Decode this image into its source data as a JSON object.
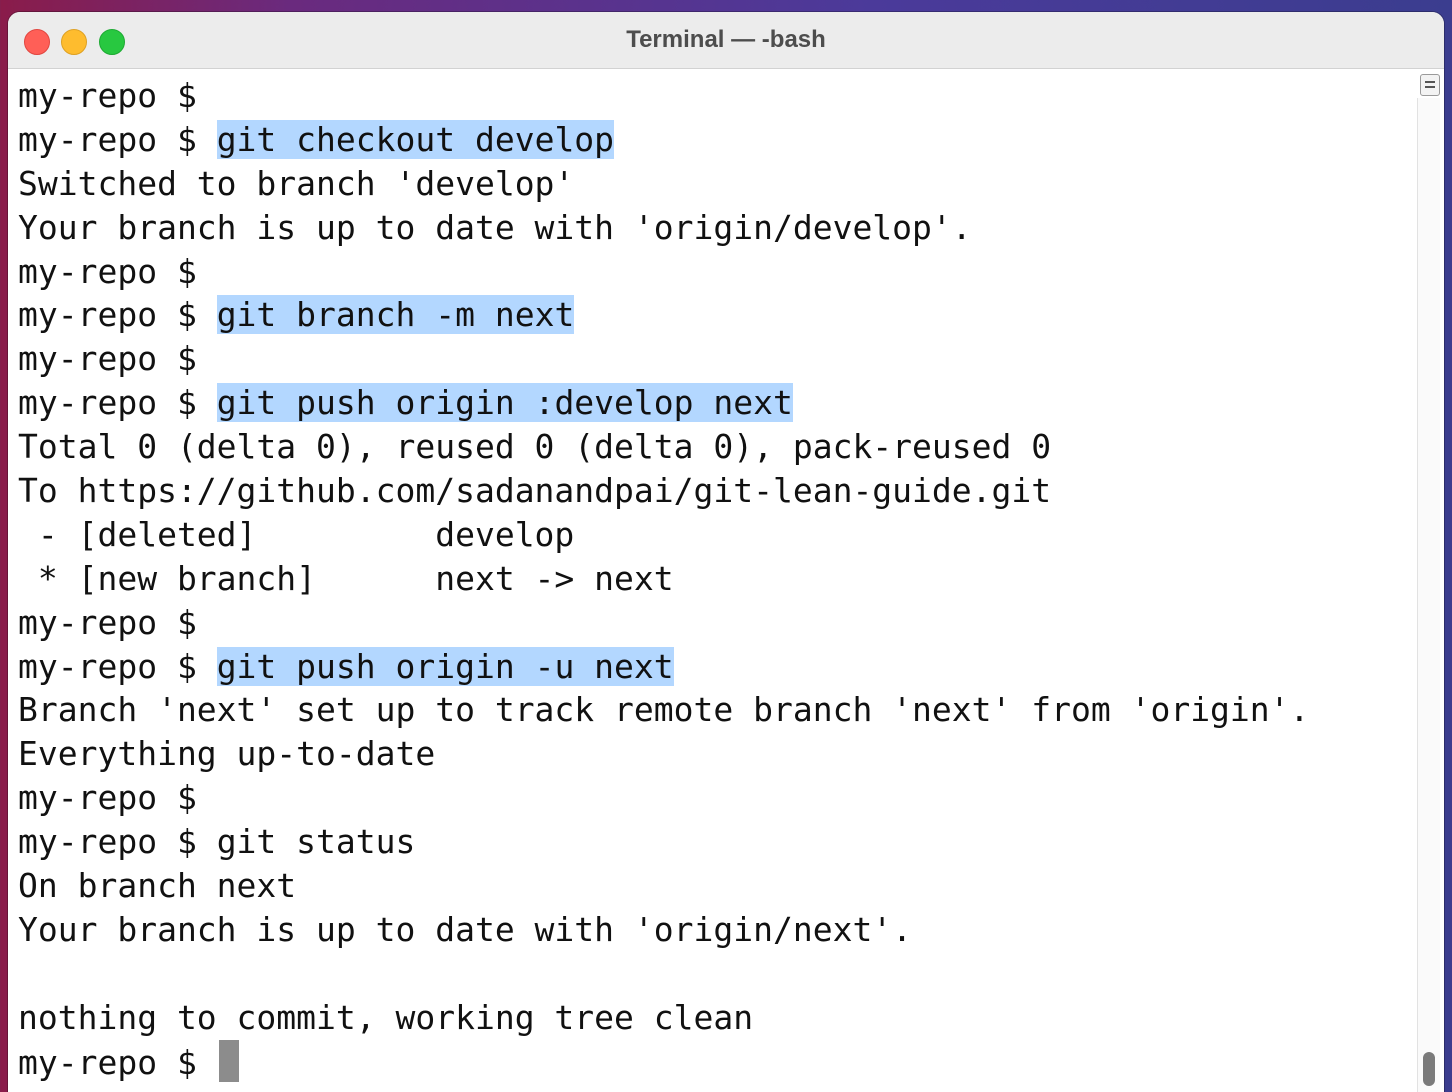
{
  "window": {
    "title": "Terminal — -bash"
  },
  "terminal": {
    "lines": [
      {
        "prompt": "my-repo $ ",
        "command": "",
        "highlight": false
      },
      {
        "prompt": "my-repo $ ",
        "command": "git checkout develop",
        "highlight": true
      },
      {
        "prompt": "",
        "command": "Switched to branch 'develop'",
        "highlight": false
      },
      {
        "prompt": "",
        "command": "Your branch is up to date with 'origin/develop'.",
        "highlight": false
      },
      {
        "prompt": "my-repo $ ",
        "command": "",
        "highlight": false
      },
      {
        "prompt": "my-repo $ ",
        "command": "git branch -m next",
        "highlight": true
      },
      {
        "prompt": "my-repo $ ",
        "command": "",
        "highlight": false
      },
      {
        "prompt": "my-repo $ ",
        "command": "git push origin :develop next",
        "highlight": true
      },
      {
        "prompt": "",
        "command": "Total 0 (delta 0), reused 0 (delta 0), pack-reused 0",
        "highlight": false
      },
      {
        "prompt": "",
        "command": "To https://github.com/sadanandpai/git-lean-guide.git",
        "highlight": false
      },
      {
        "prompt": "",
        "command": " - [deleted]         develop",
        "highlight": false
      },
      {
        "prompt": "",
        "command": " * [new branch]      next -> next",
        "highlight": false
      },
      {
        "prompt": "my-repo $ ",
        "command": "",
        "highlight": false
      },
      {
        "prompt": "my-repo $ ",
        "command": "git push origin -u next",
        "highlight": true
      },
      {
        "prompt": "",
        "command": "Branch 'next' set up to track remote branch 'next' from 'origin'.",
        "highlight": false
      },
      {
        "prompt": "",
        "command": "Everything up-to-date",
        "highlight": false
      },
      {
        "prompt": "my-repo $ ",
        "command": "",
        "highlight": false
      },
      {
        "prompt": "my-repo $ ",
        "command": "git status",
        "highlight": false
      },
      {
        "prompt": "",
        "command": "On branch next",
        "highlight": false
      },
      {
        "prompt": "",
        "command": "Your branch is up to date with 'origin/next'.",
        "highlight": false
      },
      {
        "prompt": "",
        "command": "",
        "highlight": false
      },
      {
        "prompt": "",
        "command": "nothing to commit, working tree clean",
        "highlight": false
      }
    ],
    "current_prompt": "my-repo $ "
  },
  "colors": {
    "highlight": "#b3d7ff",
    "close": "#ff5f57",
    "minimize": "#febc2e",
    "maximize": "#28c840"
  }
}
